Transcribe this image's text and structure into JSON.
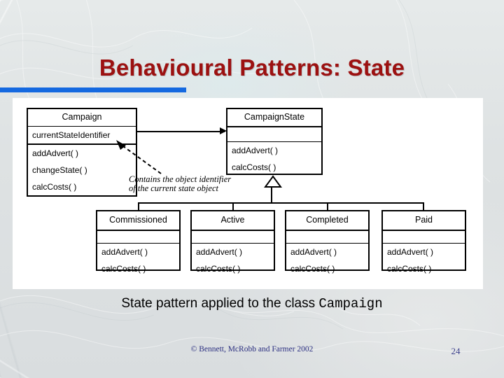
{
  "slide": {
    "title": "Behavioural Patterns: State",
    "caption_prefix": "State pattern applied to the class ",
    "caption_class": "Campaign",
    "accent_blue": "#1569e0",
    "title_color": "#9c1111",
    "footer_color": "#2b2f80"
  },
  "diagram": {
    "note": {
      "line1": "Contains the object identifier",
      "line2": "of the current state object"
    },
    "classes": {
      "campaign": {
        "name": "Campaign",
        "attributes": [
          "currentStateIdentifier"
        ],
        "operations": [
          "addAdvert( )",
          "changeState( )",
          "calcCosts( )"
        ]
      },
      "campaign_state": {
        "name": "CampaignState",
        "attributes": [
          ""
        ],
        "operations": [
          "addAdvert( )",
          "calcCosts( )"
        ]
      },
      "commissioned": {
        "name": "Commissioned",
        "attributes": [
          ""
        ],
        "operations": [
          "addAdvert( )",
          "calcCosts( )"
        ]
      },
      "active": {
        "name": "Active",
        "attributes": [
          ""
        ],
        "operations": [
          "addAdvert( )",
          "calcCosts( )"
        ]
      },
      "completed": {
        "name": "Completed",
        "attributes": [
          ""
        ],
        "operations": [
          "addAdvert( )",
          "calcCosts( )"
        ]
      },
      "paid": {
        "name": "Paid",
        "attributes": [
          ""
        ],
        "operations": [
          "addAdvert( )",
          "calcCosts( )"
        ]
      }
    }
  },
  "footer": {
    "credit": "©  Bennett, McRobb and Farmer 2002",
    "page_number": "24"
  }
}
